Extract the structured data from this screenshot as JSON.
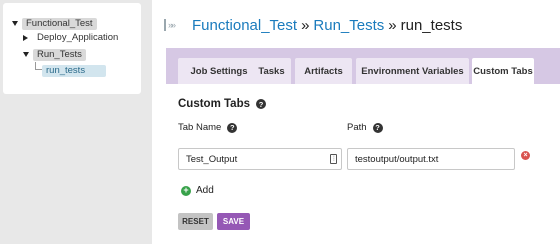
{
  "tree": {
    "items": [
      {
        "label": "Functional_Test",
        "expander": "triangle-down"
      },
      {
        "label": "Deploy_Application",
        "expander": "triangle-right"
      },
      {
        "label": "Run_Tests",
        "expander": "triangle-down"
      },
      {
        "label": "run_tests",
        "selected": true
      }
    ]
  },
  "header": {
    "crumb1": "Functional_Test",
    "sep1": "»",
    "crumb2": "Run_Tests",
    "sep2": "»",
    "current": "run_tests"
  },
  "tabs": [
    {
      "label": "Job Settings"
    },
    {
      "label": "Tasks"
    },
    {
      "label": "Artifacts"
    },
    {
      "label": "Environment Variables"
    },
    {
      "label": "Custom Tabs",
      "active": true
    }
  ],
  "section": {
    "title": "Custom Tabs",
    "col_tab_name": "Tab Name",
    "col_path": "Path"
  },
  "rows": [
    {
      "tab_name": "Test_Output",
      "path": "testoutput/output.txt"
    }
  ],
  "actions": {
    "add_label": "Add",
    "reset_label": "RESET",
    "save_label": "SAVE"
  },
  "colors": {
    "link": "#1a7bbd",
    "tabbar_bg": "#d6c8e4",
    "save_bg": "#9558b5",
    "add_icon": "#38a24a",
    "remove_icon": "#d9534f"
  }
}
